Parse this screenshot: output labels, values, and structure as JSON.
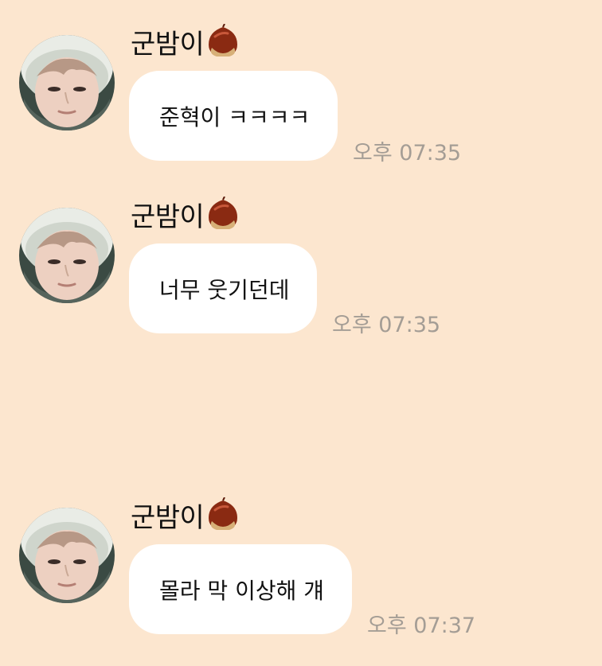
{
  "messages": [
    {
      "sender": "군밤이",
      "text": "준혁이 ㅋㅋㅋㅋ",
      "time": "오후 07:35"
    },
    {
      "sender": "군밤이",
      "text": "너무 웃기던데",
      "time": "오후 07:35"
    },
    {
      "sender": "군밤이",
      "text": "몰라 막 이상해 걔",
      "time": "오후 07:37"
    }
  ],
  "sender_emoji": "chestnut-emoji",
  "colors": {
    "background": "#fce6cf",
    "bubble": "#ffffff",
    "time": "#a49d95"
  }
}
